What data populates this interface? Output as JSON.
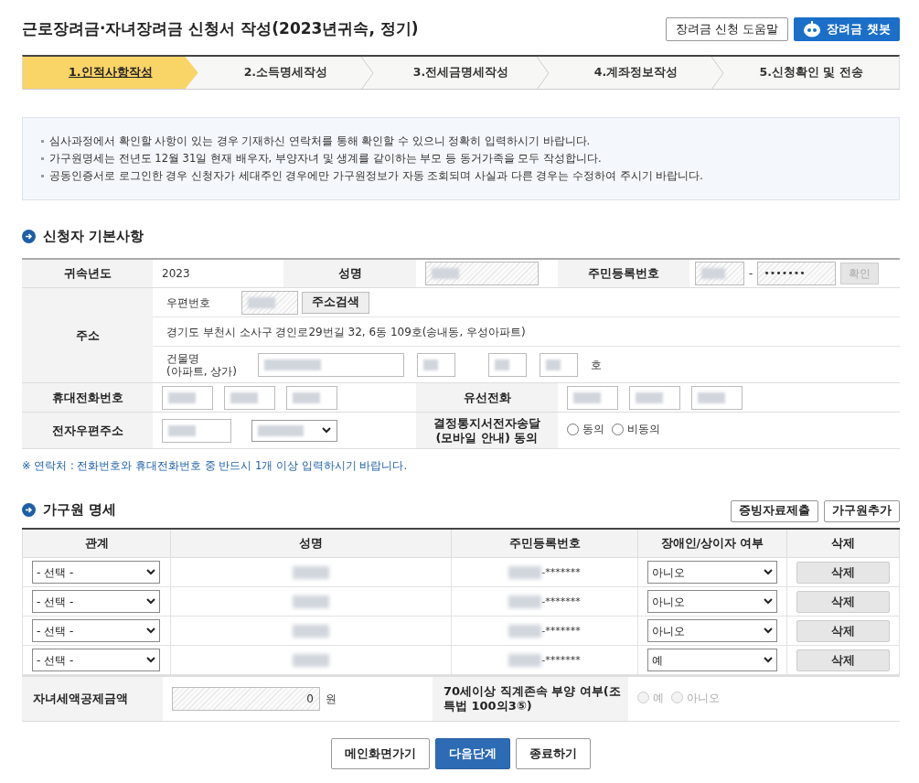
{
  "title": "근로장려금·자녀장려금 신청서 작성(2023년귀속, 정기)",
  "header_buttons": [
    {
      "label": "장려금 신청 도움말",
      "kind": "plain"
    },
    {
      "label": "장려금 챗봇",
      "kind": "chatbot"
    }
  ],
  "steps": [
    {
      "label": "1.인적사항작성",
      "selected": true
    },
    {
      "label": "2.소득명세작성",
      "selected": false
    },
    {
      "label": "3.전세금명세작성",
      "selected": false
    },
    {
      "label": "4.계좌정보작성",
      "selected": false
    },
    {
      "label": "5.신청확인 및 전송",
      "selected": false
    }
  ],
  "notices": [
    "심사과정에서 확인할 사항이 있는 경우 기재하신 연락처를 통해 확인할 수 있으니 정확히 입력하시기 바랍니다.",
    "가구원명세는 전년도 12월 31일 현재 배우자, 부양자녀 및 생계를 같이하는 부모 등 동거가족을 모두 작성합니다.",
    "공동인증서로 로그인한 경우 신청자가 세대주인 경우에만 가구원정보가 자동 조회되며 사실과 다른 경우는 수정하여 주시기 바랍니다."
  ],
  "applicant": {
    "heading": "신청자 기본사항",
    "year_label": "귀속년도",
    "year": "2023",
    "name_label": "성명",
    "rrn_label": "주민등록번호",
    "rrn_separator": "-",
    "rrn_back": "•••••••",
    "confirm_button": {
      "label": "확인",
      "disabled": true
    },
    "address_label": "주소",
    "postcode_label": "우편번호",
    "address_search_button": "주소검색",
    "address": "경기도 부천시 소사구 경인로29번길 32, 6동 109호(송내동, 우성아파트)",
    "building_label": [
      "건물명",
      "(아파트, 상가)"
    ],
    "ho": "호",
    "mobile_label": "휴대전화번호",
    "landline_label": "유선전화",
    "email_label": "전자우편주소",
    "consent_label": [
      "결정통지서전자송달",
      "(모바일 안내) 동의"
    ],
    "consent_options": [
      {
        "label": "동의",
        "selected": false
      },
      {
        "label": "비동의",
        "selected": false
      }
    ]
  },
  "contact_note": "※ 연락처 : 전화번호와 휴대전화번호 중 반드시 1개 이상 입력하시기 바랍니다.",
  "household": {
    "heading": "가구원 명세",
    "buttons": [
      "증빙자료제출",
      "가구원추가"
    ],
    "columns": [
      "관계",
      "성명",
      "주민등록번호",
      "장애인/상이자 여부",
      "삭제"
    ],
    "rows": [
      {
        "relation": "- 선택 -",
        "rrn_suffix": "-*******",
        "disability": "아니오",
        "delete_button": "삭제"
      },
      {
        "relation": "- 선택 -",
        "rrn_suffix": "-*******",
        "disability": "아니오",
        "delete_button": "삭제"
      },
      {
        "relation": "- 선택 -",
        "rrn_suffix": "-*******",
        "disability": "아니오",
        "delete_button": "삭제"
      },
      {
        "relation": "- 선택 -",
        "rrn_suffix": "-*******",
        "disability": "예",
        "delete_button": "삭제"
      }
    ]
  },
  "child_credit": {
    "label": "자녀세액공제금액",
    "value": "0",
    "unit": "원",
    "elder_label": "70세이상 직계존속 부양 여부(조특법 100의3⑤)",
    "elder_options": [
      {
        "label": "예",
        "selected": false,
        "disabled": true
      },
      {
        "label": "아니오",
        "selected": false,
        "disabled": true
      }
    ]
  },
  "footer_buttons": [
    {
      "label": "메인화면가기",
      "kind": "plain"
    },
    {
      "label": "다음단계",
      "kind": "primary"
    },
    {
      "label": "종료하기",
      "kind": "plain"
    }
  ]
}
